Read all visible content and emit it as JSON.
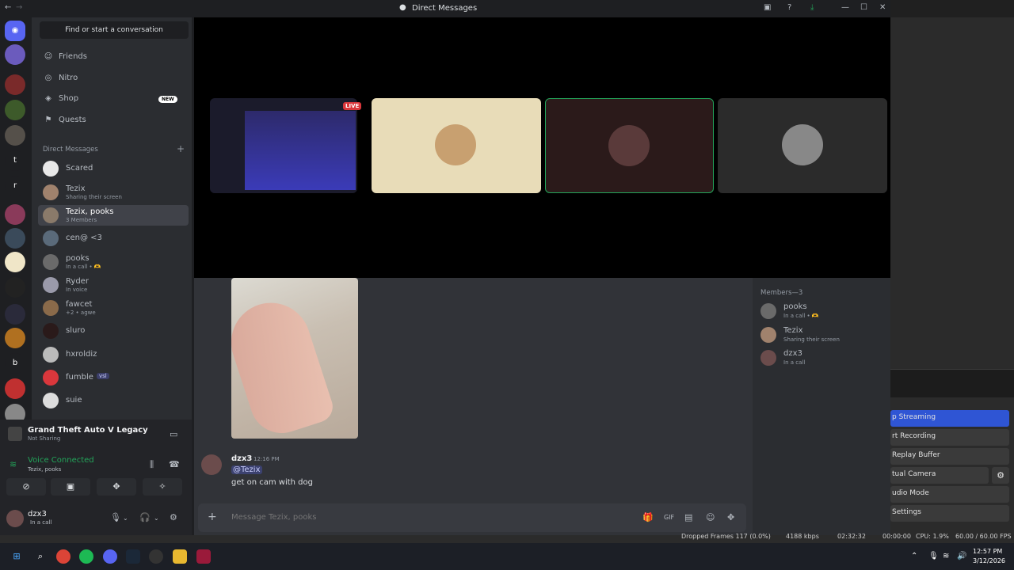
{
  "window": {
    "title": "Direct Messages"
  },
  "sidebar": {
    "find_placeholder": "Find or start a conversation",
    "nav": [
      {
        "label": "Friends"
      },
      {
        "label": "Nitro"
      },
      {
        "label": "Shop",
        "badge": "NEW"
      },
      {
        "label": "Quests"
      }
    ],
    "dm_header": "Direct Messages",
    "dms": [
      {
        "name": "Scared",
        "sub": ""
      },
      {
        "name": "Tezix",
        "sub": "Sharing their screen"
      },
      {
        "name": "Tezix, pooks",
        "sub": "3 Members"
      },
      {
        "name": "cen@ <3",
        "sub": ""
      },
      {
        "name": "pooks",
        "sub": "In a call • 🫶"
      },
      {
        "name": "Ryder",
        "sub": "In voice"
      },
      {
        "name": "fawcet",
        "sub": "+2 • agwe"
      },
      {
        "name": "sluro",
        "sub": ""
      },
      {
        "name": "hxroldiz",
        "sub": ""
      },
      {
        "name": "fumble",
        "sub": "",
        "tag": "vsl"
      },
      {
        "name": "suie",
        "sub": ""
      }
    ]
  },
  "activity": {
    "game_title": "Grand Theft Auto V Legacy",
    "game_sub": "Not Sharing",
    "voice_label": "Voice Connected",
    "voice_sub": "Tezix, pooks"
  },
  "user": {
    "name": "dzx3",
    "status": "In a call"
  },
  "stage": {
    "live_label": "LIVE"
  },
  "chat": {
    "message": {
      "author": "dzx3",
      "time": "12:16 PM",
      "mention": "@Tezix",
      "text": "get on cam with dog"
    },
    "composer_placeholder": "Message Tezix, pooks"
  },
  "members": {
    "header": "Members—3",
    "list": [
      {
        "name": "pooks",
        "sub": "In a call • 🫶"
      },
      {
        "name": "Tezix",
        "sub": "Sharing their screen"
      },
      {
        "name": "dzx3",
        "sub": "In a call"
      }
    ]
  },
  "obs": {
    "buttons": [
      "p Streaming",
      "rt Recording",
      "Replay Buffer",
      "tual Camera",
      "udio Mode",
      "Settings"
    ],
    "status": {
      "dropped": "Dropped Frames 117 (0.0%)",
      "kbps": "4188 kbps",
      "time1": "02:32:32",
      "time2": "00:00:00",
      "cpu": "CPU: 1.9%",
      "fps": "60.00 / 60.00 FPS"
    }
  },
  "taskbar": {
    "time": "12:57 PM",
    "date": "3/12/2026"
  },
  "colors": {
    "accent": "#5865f2",
    "online_green": "#23a55a",
    "live_red": "#da373c",
    "obs_blue": "#2f55d4"
  }
}
